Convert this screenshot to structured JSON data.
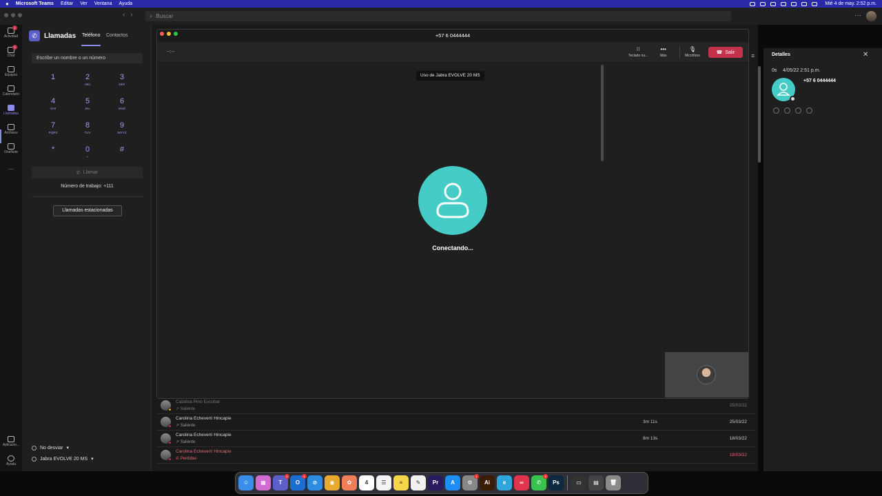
{
  "menubar": {
    "app": "Microsoft Teams",
    "items": [
      "Editar",
      "Ver",
      "Ventana",
      "Ayuda"
    ],
    "clock": "Mié 4 de may.  2:52 p.m."
  },
  "titlebar": {
    "search_placeholder": "Buscar"
  },
  "rail": {
    "items": [
      {
        "label": "Actividad",
        "badge": "2"
      },
      {
        "label": "Chat",
        "badge": "3"
      },
      {
        "label": "Equipos"
      },
      {
        "label": "Calendario"
      },
      {
        "label": "Llamadas"
      },
      {
        "label": "Archivos"
      },
      {
        "label": "OneNote"
      },
      {
        "label": "···"
      }
    ],
    "bottom": [
      {
        "label": "Aplicacio..."
      },
      {
        "label": "Ayuda"
      }
    ]
  },
  "calls": {
    "title": "Llamadas",
    "tabs": [
      "Teléfono",
      "Contactos"
    ],
    "dial_placeholder": "Escribe un nombre o un número",
    "keys": [
      {
        "num": "1",
        "letters": ""
      },
      {
        "num": "2",
        "letters": "ABC"
      },
      {
        "num": "3",
        "letters": "DEF"
      },
      {
        "num": "4",
        "letters": "GHI"
      },
      {
        "num": "5",
        "letters": "JKL"
      },
      {
        "num": "6",
        "letters": "MNO"
      },
      {
        "num": "7",
        "letters": "PQRS"
      },
      {
        "num": "8",
        "letters": "TUV"
      },
      {
        "num": "9",
        "letters": "WXYZ"
      },
      {
        "num": "*",
        "letters": ""
      },
      {
        "num": "0",
        "letters": "+"
      },
      {
        "num": "#",
        "letters": ""
      }
    ],
    "call_label": "Llamar",
    "work_number": "Número de trabajo: +111",
    "parked_label": "Llamadas estacionadas",
    "forwarding": "No desviar",
    "device": "Jabra EVOLVE 20 MS"
  },
  "history": {
    "rows": [
      {
        "name": "Catalina Pino Escobar",
        "kind": "Saliente",
        "duration": "",
        "date": "25/03/22",
        "state": "dim"
      },
      {
        "name": "Carolina Echeverri Hincapie",
        "kind": "Saliente",
        "duration": "3m 11s",
        "date": "25/03/22",
        "state": ""
      },
      {
        "name": "Carolina Echeverri Hincapie",
        "kind": "Saliente",
        "duration": "8m 13s",
        "date": "18/03/22",
        "state": ""
      },
      {
        "name": "Carolina Echeverri Hincapie",
        "kind": "Perdidas",
        "duration": "",
        "date": "18/03/22",
        "state": "missed"
      }
    ]
  },
  "details": {
    "title": "Detalles",
    "duration": "0s",
    "datetime": "4/05/22 2:51 p.m.",
    "number": "+57 6 0444444"
  },
  "call_window": {
    "title": "+57 6 0444444",
    "timer": "--:--",
    "tools": {
      "keypad": "Teclado nu...",
      "more": "Más",
      "mic": "Micrófono"
    },
    "leave_label": "Salir",
    "device_tip": "Uso de Jabra EVOLVE 20 MS",
    "status": "Conectando..."
  },
  "dock": {
    "apps": [
      {
        "name": "finder",
        "color": "#3b8ee8",
        "glyph": "☺"
      },
      {
        "name": "launchpad",
        "color": "#d06bd0",
        "glyph": "▦"
      },
      {
        "name": "teams",
        "color": "#5b5fc7",
        "glyph": "T",
        "badge": "1"
      },
      {
        "name": "outlook",
        "color": "#1c6fd1",
        "glyph": "O",
        "badge": "1"
      },
      {
        "name": "safari",
        "color": "#2d8ce0",
        "glyph": "⊘"
      },
      {
        "name": "chrome",
        "color": "#e8a92f",
        "glyph": "◉"
      },
      {
        "name": "photos",
        "color": "#f07d55",
        "glyph": "✿"
      },
      {
        "name": "calendar",
        "color": "#ffffff",
        "glyph": "4"
      },
      {
        "name": "reminders",
        "color": "#f4f4f4",
        "glyph": "☰"
      },
      {
        "name": "notes",
        "color": "#f6d548",
        "glyph": "≡"
      },
      {
        "name": "freeform",
        "color": "#f1f1f1",
        "glyph": "✎"
      },
      {
        "name": "premiere",
        "color": "#2a1a5e",
        "glyph": "Pr"
      },
      {
        "name": "app-store",
        "color": "#1e8ef5",
        "glyph": "A"
      },
      {
        "name": "system-preferences",
        "color": "#888888",
        "glyph": "⚙",
        "badge": "1"
      },
      {
        "name": "illustrator",
        "color": "#3b1d07",
        "glyph": "Ai"
      },
      {
        "name": "edge",
        "color": "#2fa6d9",
        "glyph": "e"
      },
      {
        "name": "creative-cloud",
        "color": "#e0334c",
        "glyph": "∞"
      },
      {
        "name": "whatsapp",
        "color": "#37c34e",
        "glyph": "✆",
        "badge": "3"
      },
      {
        "name": "photoshop",
        "color": "#0c2940",
        "glyph": "Ps"
      },
      {
        "name": "screenshot",
        "color": "#333333",
        "glyph": "▭"
      },
      {
        "name": "terminal",
        "color": "#444444",
        "glyph": "▤"
      },
      {
        "name": "trash",
        "color": "#8a8a8a",
        "glyph": "🗑"
      }
    ]
  },
  "colors": {
    "accent": "#8b8ce6",
    "leave": "#c4314b",
    "avatar": "#46ccc7",
    "menubar": "#2a2aa8"
  }
}
